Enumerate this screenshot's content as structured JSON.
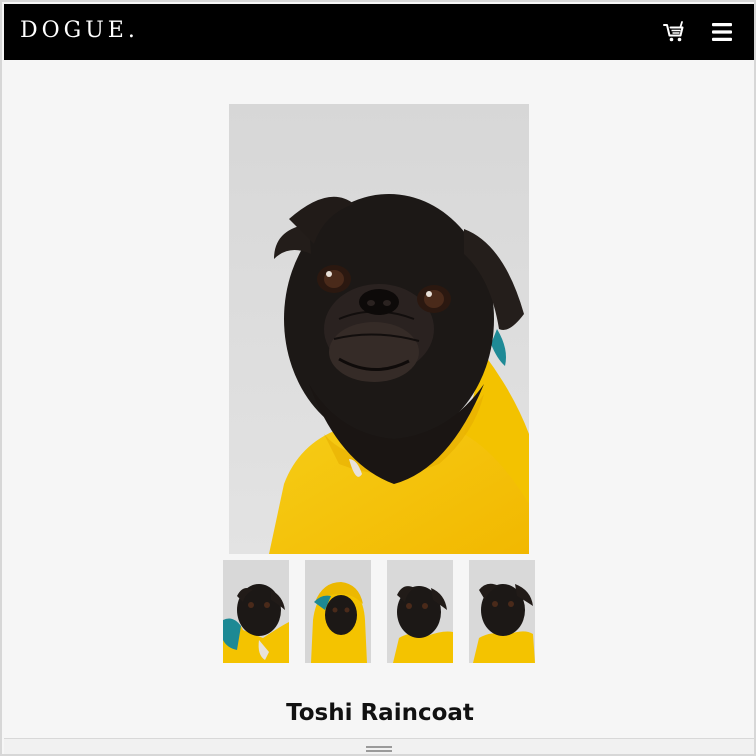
{
  "header": {
    "logo_text": "DOGUE.",
    "background": "#000000",
    "icons": [
      "cart-icon",
      "menu-icon"
    ]
  },
  "gallery": {
    "main_image": "black-pug-in-yellow-raincoat-photo",
    "thumbnails": [
      "pug-raincoat-front-view-thumbnail",
      "pug-raincoat-hood-up-thumbnail",
      "pug-raincoat-side-view-thumbnail",
      "pug-raincoat-head-tilt-thumbnail"
    ]
  },
  "product": {
    "title": "Toshi Raincoat"
  },
  "colors": {
    "header": "#000000",
    "page_background": "#f6f6f6",
    "raincoat_yellow": "#f5c400",
    "pug_black": "#1c1816",
    "photo_background": "#d9d9d9"
  }
}
